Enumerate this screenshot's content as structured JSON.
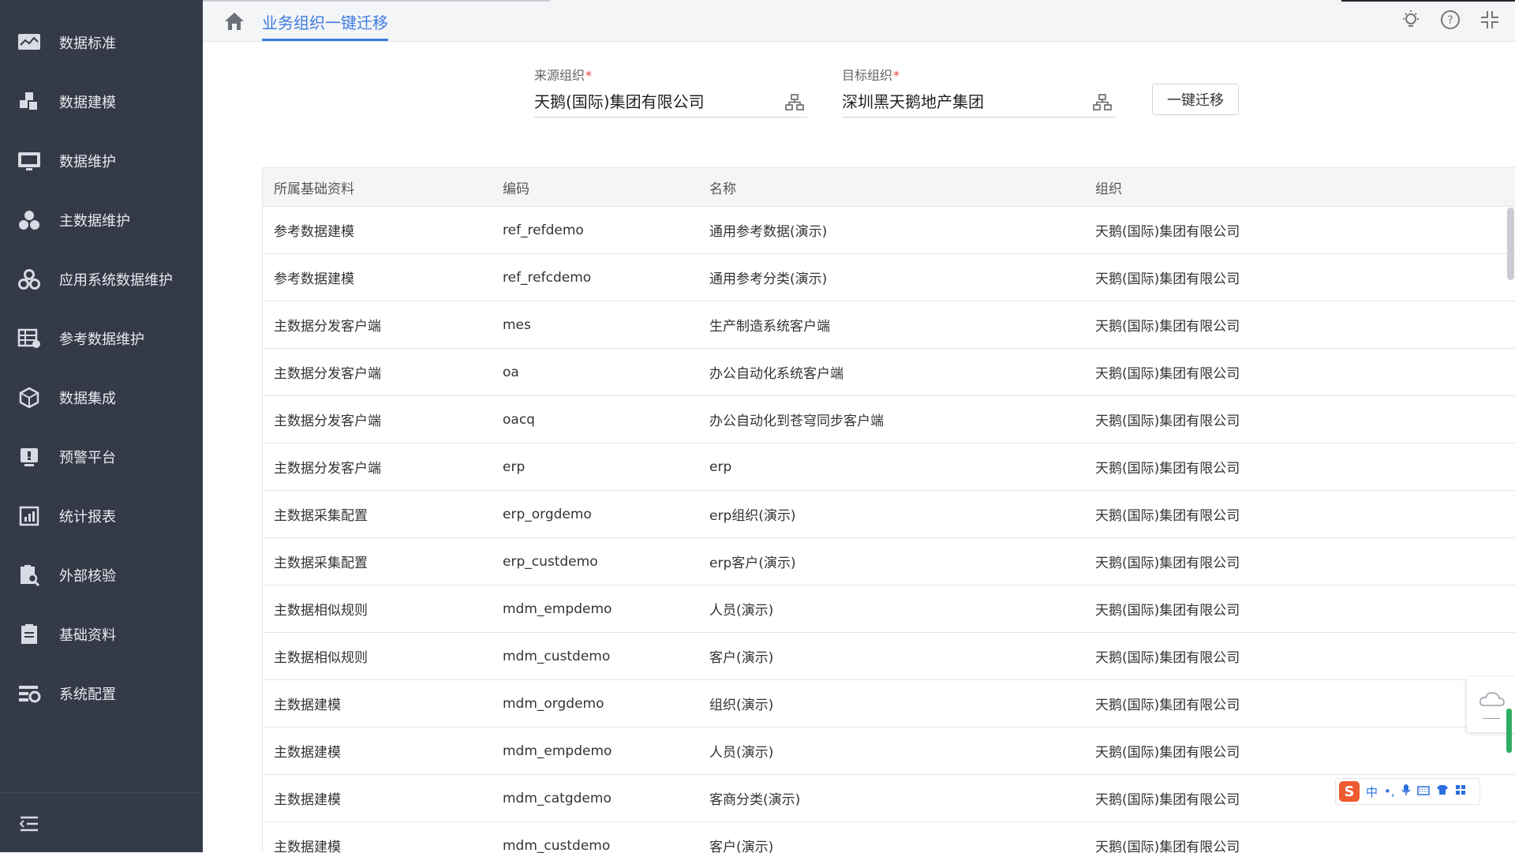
{
  "sidebar": {
    "items": [
      {
        "label": "数据标准",
        "icon": "chart-monitor-icon"
      },
      {
        "label": "数据建模",
        "icon": "puzzle-icon"
      },
      {
        "label": "数据维护",
        "icon": "screen-icon"
      },
      {
        "label": "主数据维护",
        "icon": "cluster-icon"
      },
      {
        "label": "应用系统数据维护",
        "icon": "gears-icon"
      },
      {
        "label": "参考数据维护",
        "icon": "table-edit-icon"
      },
      {
        "label": "数据集成",
        "icon": "cube-icon"
      },
      {
        "label": "预警平台",
        "icon": "alert-screen-icon"
      },
      {
        "label": "统计报表",
        "icon": "report-icon"
      },
      {
        "label": "外部核验",
        "icon": "clipboard-search-icon"
      },
      {
        "label": "基础资料",
        "icon": "document-icon"
      },
      {
        "label": "系统配置",
        "icon": "settings-list-icon"
      }
    ],
    "collapse_icon": "collapse-menu-icon"
  },
  "header": {
    "tab_title": "业务组织一键迁移",
    "icons": [
      "bulb-icon",
      "help-icon",
      "exit-fullscreen-icon"
    ]
  },
  "form": {
    "source": {
      "label": "来源组织",
      "required": "*",
      "value": "天鹅(国际)集团有限公司"
    },
    "target": {
      "label": "目标组织",
      "required": "*",
      "value": "深圳黑天鹅地产集团"
    },
    "migrate_button": "一键迁移"
  },
  "table": {
    "headers": [
      "所属基础资料",
      "编码",
      "名称",
      "组织"
    ],
    "rows": [
      [
        "参考数据建模",
        "ref_refdemo",
        "通用参考数据(演示)",
        "天鹅(国际)集团有限公司"
      ],
      [
        "参考数据建模",
        "ref_refcdemo",
        "通用参考分类(演示)",
        "天鹅(国际)集团有限公司"
      ],
      [
        "主数据分发客户端",
        "mes",
        "生产制造系统客户端",
        "天鹅(国际)集团有限公司"
      ],
      [
        "主数据分发客户端",
        "oa",
        "办公自动化系统客户端",
        "天鹅(国际)集团有限公司"
      ],
      [
        "主数据分发客户端",
        "oacq",
        "办公自动化到苍穹同步客户端",
        "天鹅(国际)集团有限公司"
      ],
      [
        "主数据分发客户端",
        "erp",
        "erp",
        "天鹅(国际)集团有限公司"
      ],
      [
        "主数据采集配置",
        "erp_orgdemo",
        "erp组织(演示)",
        "天鹅(国际)集团有限公司"
      ],
      [
        "主数据采集配置",
        "erp_custdemo",
        "erp客户(演示)",
        "天鹅(国际)集团有限公司"
      ],
      [
        "主数据相似规则",
        "mdm_empdemo",
        "人员(演示)",
        "天鹅(国际)集团有限公司"
      ],
      [
        "主数据相似规则",
        "mdm_custdemo",
        "客户(演示)",
        "天鹅(国际)集团有限公司"
      ],
      [
        "主数据建模",
        "mdm_orgdemo",
        "组织(演示)",
        "天鹅(国际)集团有限公司"
      ],
      [
        "主数据建模",
        "mdm_empdemo",
        "人员(演示)",
        "天鹅(国际)集团有限公司"
      ],
      [
        "主数据建模",
        "mdm_catgdemo",
        "客商分类(演示)",
        "天鹅(国际)集团有限公司"
      ],
      [
        "主数据建模",
        "mdm_custdemo",
        "客户(演示)",
        "天鹅(国际)集团有限公司"
      ]
    ]
  },
  "ime": {
    "logo": "S",
    "items": [
      "中",
      "•,",
      "mic-icon",
      "keyboard-icon",
      "shirt-icon",
      "grid-icon"
    ]
  }
}
